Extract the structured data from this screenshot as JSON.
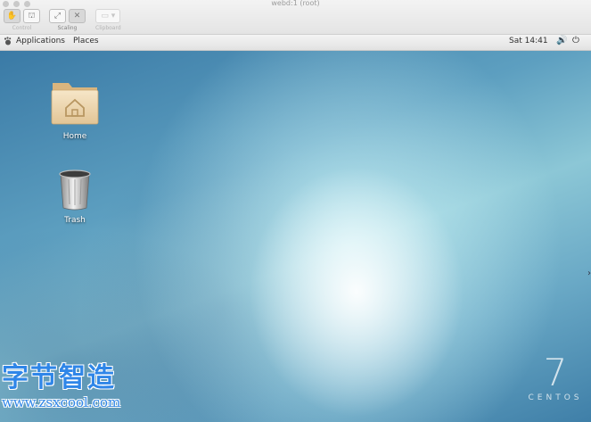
{
  "window": {
    "title": "webd:1 (root)"
  },
  "viewer_toolbar": {
    "groups": [
      {
        "label": "Control",
        "buttons": [
          "hand-icon",
          "tool-icon"
        ],
        "enabled": false
      },
      {
        "label": "Scaling",
        "buttons": [
          "fit-icon",
          "fullscreen-icon"
        ],
        "enabled": true
      },
      {
        "label": "Clipboard",
        "buttons": [
          "clipboard-icon"
        ],
        "enabled": false
      }
    ]
  },
  "panel": {
    "applications": "Applications",
    "places": "Places",
    "clock": "Sat 14:41"
  },
  "desktop": {
    "icons": [
      {
        "label": "Home",
        "icon": "home-folder-icon"
      },
      {
        "label": "Trash",
        "icon": "trash-icon"
      }
    ],
    "brand_number": "7",
    "brand_word": "CENTOS"
  },
  "watermark": {
    "chinese": "字节智造",
    "url": "www.zsxcool.com"
  },
  "colors": {
    "watermark": "#2f86e8",
    "desktop_base": "#5d9fc0"
  }
}
